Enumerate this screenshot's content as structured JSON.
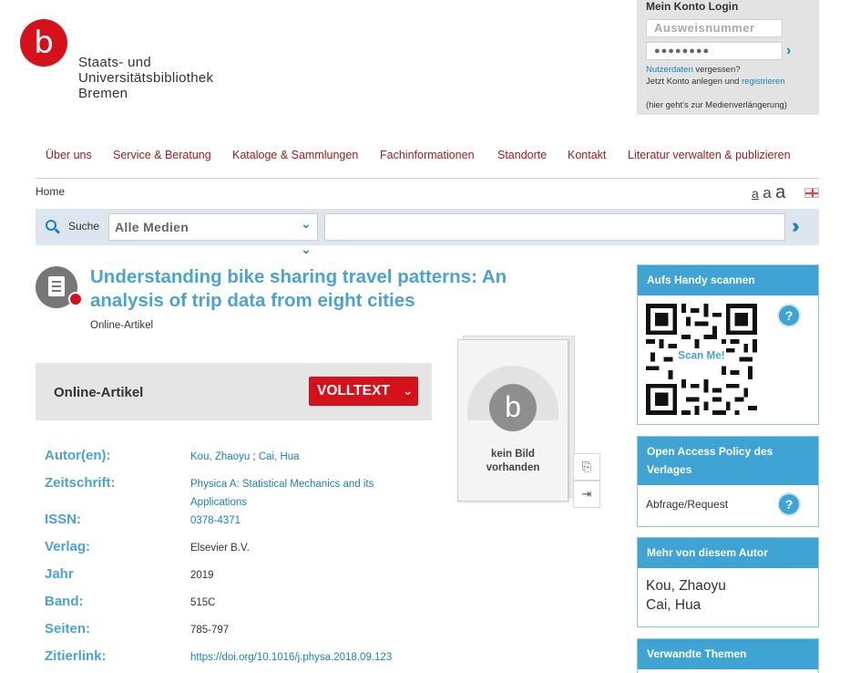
{
  "logo": {
    "letter": "b",
    "name_lines": [
      "Staats- und",
      "Universitätsbibliothek",
      "Bremen"
    ]
  },
  "login": {
    "title": "Mein Konto Login",
    "user_placeholder": "Ausweisnummer",
    "password_mask": "●●●●●●●●",
    "forgot_link": "Nutzerdaten",
    "forgot_suffix": " vergessen?",
    "register_prefix": "Jetzt Konto anlegen und ",
    "register_link": "registrieren",
    "note": "(hier geht's zur Medienverlängerung)"
  },
  "nav": {
    "items": [
      "Über uns",
      "Service & Beratung",
      "Kataloge & Sammlungen",
      "Fachinformationen",
      "Standorte",
      "Kontakt",
      "Literatur verwalten & publizieren"
    ]
  },
  "breadcrumb": {
    "home": "Home"
  },
  "font_sizes": [
    "a",
    "a",
    "a"
  ],
  "search": {
    "label": "Suche",
    "scope": "Alle Medien",
    "query": ""
  },
  "record": {
    "title": "Understanding bike sharing travel patterns: An analysis of trip data from eight cities",
    "type": "Online-Artikel",
    "access_label": "Online-Artikel",
    "fulltext_button": "VOLLTEXT",
    "cover_caption_line1": "kein Bild",
    "cover_caption_line2": "vorhanden",
    "cover_letter": "b"
  },
  "details": {
    "author_label": "Autor(en):",
    "author_1": "Kou, Zhaoyu",
    "author_sep": " ; ",
    "author_2": "Cai, Hua",
    "journal_label": "Zeitschrift:",
    "journal": "Physica A: Statistical Mechanics and its Applications",
    "issn_label": "ISSN:",
    "issn": "0378-4371",
    "publisher_label": "Verlag:",
    "publisher": "Elsevier B.V.",
    "year_label": "Jahr",
    "year": "2019",
    "volume_label": "Band:",
    "volume": "515C",
    "pages_label": "Seiten:",
    "pages": "785-797",
    "cite_label": "Zitierlink:",
    "cite": "https://doi.org/10.1016/j.physa.2018.09.123"
  },
  "sidebar": {
    "qr_title": "Aufs Handy scannen",
    "qr_overlay": "Scan Me!",
    "oa_title": "Open Access Policy des Verlages",
    "oa_text": "Abfrage/Request",
    "more_title": "Mehr von diesem Autor",
    "more_authors": [
      "Kou, Zhaoyu",
      "Cai, Hua"
    ],
    "related_title": "Verwandte Themen",
    "help": "?"
  },
  "colors": {
    "brand_red": "#d5121b",
    "nav_red": "#a11c22",
    "accent_blue": "#4aa3d2",
    "link_blue": "#1b82b8",
    "panel_blue": "#3fa4d4"
  }
}
